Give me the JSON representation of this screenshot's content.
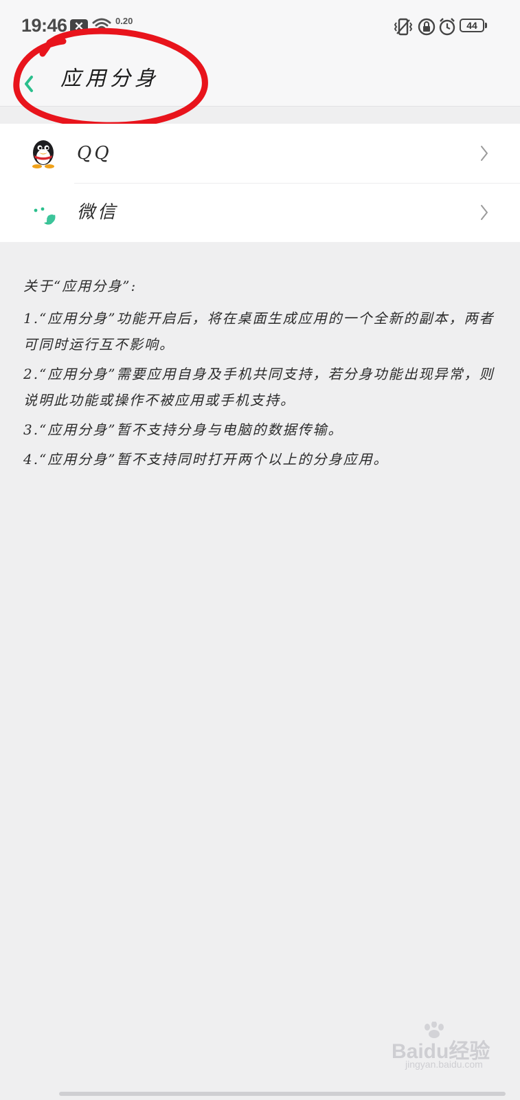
{
  "status_bar": {
    "time": "19:46",
    "notification_icon": "x-notification-icon",
    "network_speed": "0.20",
    "battery_level": "44"
  },
  "header": {
    "title": "应用分身",
    "back_icon": "chevron-left-icon"
  },
  "apps": [
    {
      "name": "QQ",
      "icon": "qq-penguin-icon"
    },
    {
      "name": "微信",
      "icon": "wechat-icon"
    }
  ],
  "info": {
    "heading": "关于“应用分身”:",
    "items": [
      "1.“应用分身”功能开启后，将在桌面生成应用的一个全新的副本，两者可同时运行互不影响。",
      "2.“应用分身”需要应用自身及手机共同支持，若分身功能出现异常，则说明此功能或操作不被应用或手机支持。",
      "3.“应用分身”暂不支持分身与电脑的数据传输。",
      "4.“应用分身”暂不支持同时打开两个以上的分身应用。"
    ]
  },
  "watermark": {
    "brand": "Baidu经验",
    "url": "jingyan.baidu.com"
  },
  "colors": {
    "accent": "#2bbf8d",
    "annotation": "#e8141c",
    "background": "#efeff0"
  }
}
